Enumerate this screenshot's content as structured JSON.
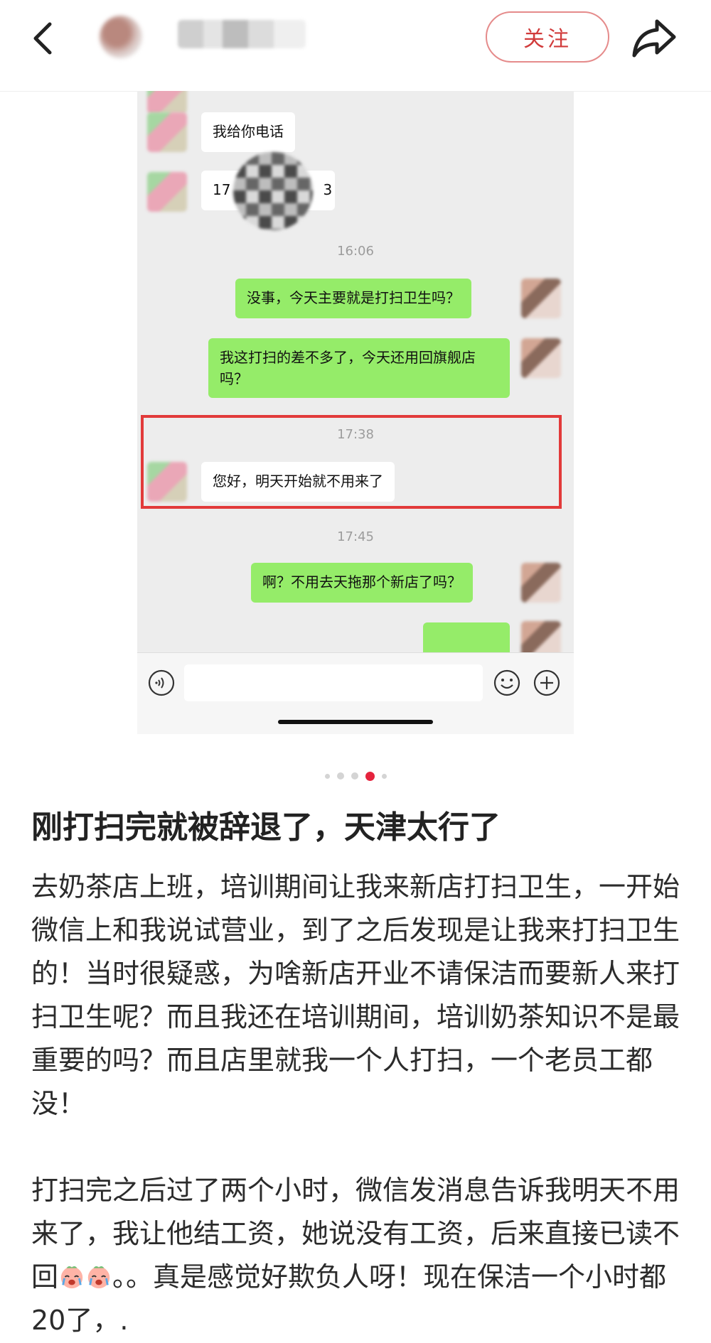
{
  "header": {
    "follow_label": "关注",
    "back_icon": "back-arrow-icon",
    "share_icon": "share-arrow-icon"
  },
  "chat": {
    "messages": [
      {
        "side": "left",
        "text": "我给你电话"
      },
      {
        "side": "left",
        "text_start": "17",
        "text_end": "3"
      },
      {
        "time": "16:06"
      },
      {
        "side": "right",
        "text": "没事，今天主要就是打扫卫生吗？"
      },
      {
        "side": "right",
        "text": "我这打扫的差不多了，今天还用回旗舰店吗？"
      },
      {
        "time": "17:38"
      },
      {
        "side": "left",
        "text": "您好，明天开始就不用来了"
      },
      {
        "time": "17:45"
      },
      {
        "side": "right",
        "text": "啊？不用去天拖那个新店了吗？"
      }
    ],
    "colors": {
      "right_bubble": "#95ec69",
      "left_bubble": "#ffffff",
      "highlight": "#e23a3a"
    }
  },
  "carousel": {
    "count": 5,
    "active_index": 3,
    "active_color": "#e5233d"
  },
  "post": {
    "title": "刚打扫完就被辞退了，天津太行了",
    "paragraph1": "去奶茶店上班，培训期间让我来新店打扫卫生，一开始微信上和我说试营业，到了之后发现是让我来打扫卫生的！当时很疑惑，为啥新店开业不请保洁而要新人来打扫卫生呢？而且我还在培训期间，培训奶茶知识不是最重要的吗？而且店里就我一个人打扫，一个老员工都没！",
    "paragraph2_a": "打扫完之后过了两个小时，微信发消息告诉我明天不用来了，我让他结工资，她说没有工资，后来直接已读不回",
    "paragraph2_b": "。。真是感觉好欺负人呀！现在保洁一个小时都20了，."
  }
}
